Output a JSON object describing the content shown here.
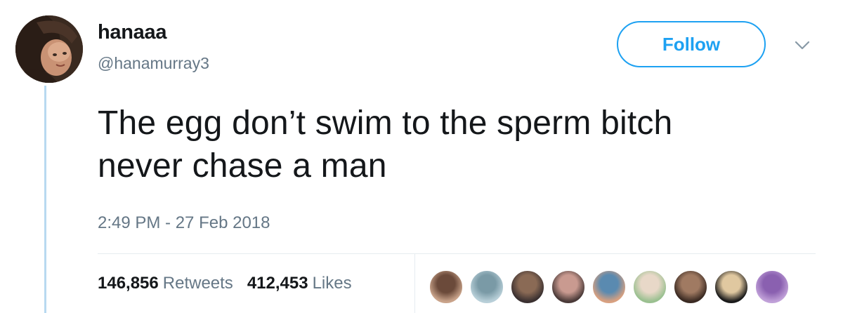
{
  "user": {
    "display_name": "hanaaa",
    "handle": "@hanamurray3",
    "avatar_icon": "profile-photo"
  },
  "actions": {
    "follow_label": "Follow",
    "menu_icon": "chevron-down-icon"
  },
  "tweet": {
    "text_line1": "The egg don’t swim to the sperm bitch",
    "text_line2": "never chase a man",
    "timestamp": "2:49 PM - 27 Feb 2018"
  },
  "stats": {
    "retweets_count": "146,856",
    "retweets_label": "Retweets",
    "likes_count": "412,453",
    "likes_label": "Likes"
  },
  "colors": {
    "accent": "#1da1f2",
    "text_primary": "#14171a",
    "text_secondary": "#657786",
    "thread_line": "#b8d9f0",
    "divider": "#e6ecf0"
  },
  "likers": [
    {
      "name": "liker-avatar-1",
      "colors": [
        "#c9a38a",
        "#6b4a3a"
      ]
    },
    {
      "name": "liker-avatar-2",
      "colors": [
        "#b8cfd8",
        "#7a9aa6"
      ]
    },
    {
      "name": "liker-avatar-3",
      "colors": [
        "#3a3030",
        "#8a6a55"
      ]
    },
    {
      "name": "liker-avatar-4",
      "colors": [
        "#4a3a38",
        "#c99a90"
      ]
    },
    {
      "name": "liker-avatar-5",
      "colors": [
        "#d8a080",
        "#5a8ab0"
      ]
    },
    {
      "name": "liker-avatar-6",
      "colors": [
        "#9ac090",
        "#e8d8c8"
      ]
    },
    {
      "name": "liker-avatar-7",
      "colors": [
        "#3a2a22",
        "#a07a62"
      ]
    },
    {
      "name": "liker-avatar-8",
      "colors": [
        "#1a1a1a",
        "#e0c8a0"
      ]
    },
    {
      "name": "liker-avatar-9",
      "colors": [
        "#c0a0d8",
        "#8a60b0"
      ]
    }
  ]
}
